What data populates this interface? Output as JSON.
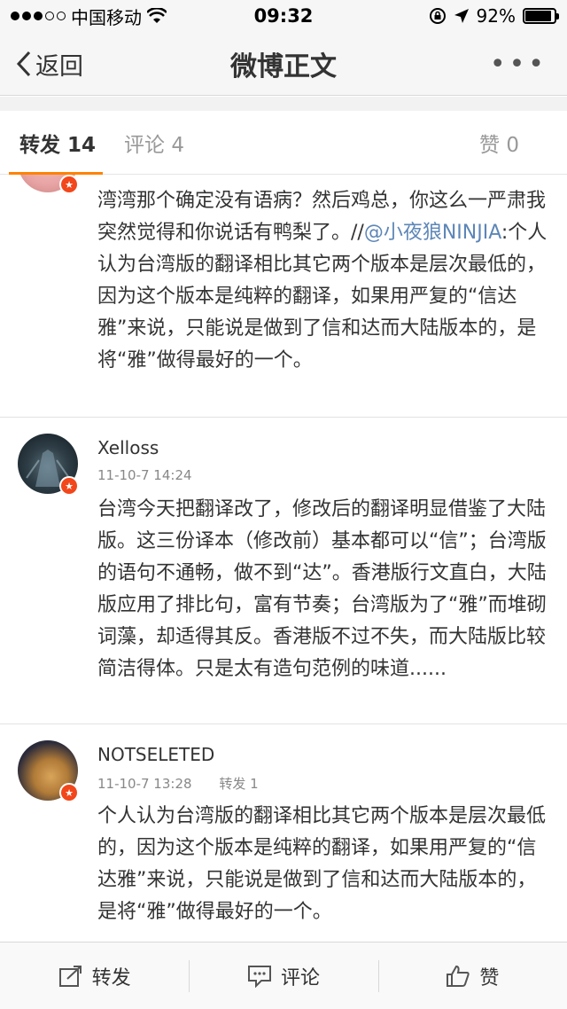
{
  "status_bar": {
    "carrier": "中国移动",
    "time": "09:32",
    "battery": "92%",
    "battery_level": 0.92
  },
  "nav": {
    "back_label": "返回",
    "title": "微博正文"
  },
  "tabs": {
    "reposts": "转发 14",
    "comments": "评论 4",
    "likes": "赞 0"
  },
  "feed": {
    "item0": {
      "text_before": "湾湾那个确定没有语病？然后鸡总，你这么一严肃我突然觉得和你说话有鸭梨了。//",
      "mention": "@小夜狼NINJIA",
      "text_after": ":个人认为台湾版的翻译相比其它两个版本是层次最低的，因为这个版本是纯粹的翻译，如果用严复的“信达雅”来说，只能说是做到了信和达而大陆版本的，是将“雅”做得最好的一个。"
    },
    "item1": {
      "username": "Xelloss",
      "time": "11-10-7 14:24",
      "text": "台湾今天把翻译改了，修改后的翻译明显借鉴了大陆版。这三份译本（修改前）基本都可以“信”；台湾版的语句不通畅，做不到“达”。香港版行文直白，大陆版应用了排比句，富有节奏；台湾版为了“雅”而堆砌词藻，却适得其反。香港版不过不失，而大陆版比较简洁得体。只是太有造句范例的味道......"
    },
    "item2": {
      "username": "NOTSELETED",
      "time": "11-10-7 13:28",
      "reposts": "转发 1",
      "text": "个人认为台湾版的翻译相比其它两个版本是层次最低的，因为这个版本是纯粹的翻译，如果用严复的“信达雅”来说，只能说是做到了信和达而大陆版本的，是将“雅”做得最好的一个。"
    }
  },
  "toolbar": {
    "repost": "转发",
    "comment": "评论",
    "like": "赞"
  },
  "colors": {
    "accent": "#ff8200",
    "mention": "#5d86b7",
    "badge": "#f2461b"
  }
}
